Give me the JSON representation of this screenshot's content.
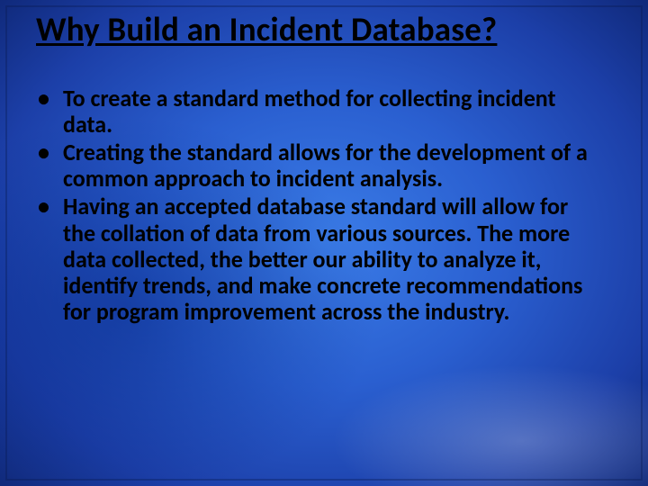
{
  "slide": {
    "title": "Why Build an Incident Database?",
    "bullets": [
      "To create a standard method for collecting incident data.",
      "Creating the standard allows for the development of a common approach to incident analysis.",
      "Having an accepted database standard will allow for the collation of data from various sources. The more data collected, the better our ability to analyze it, identify trends, and make concrete recommendations for program improvement across the industry."
    ]
  }
}
